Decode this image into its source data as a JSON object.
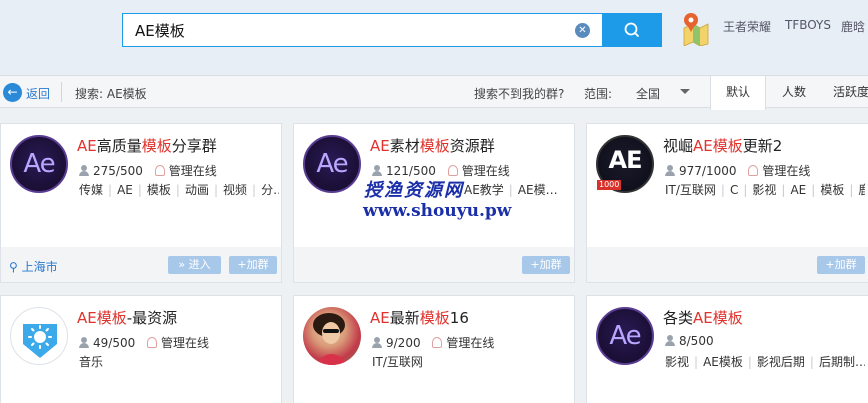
{
  "search": {
    "value": "AE模板",
    "clear_glyph": "✕"
  },
  "hot_tags": [
    "王者荣耀",
    "TFBOYS",
    "鹿晗"
  ],
  "filter_bar": {
    "back_label": "返回",
    "search_label": "搜索: AE模板",
    "not_found": "搜索不到我的群?",
    "range_label": "范围:",
    "range_value": "全国",
    "sort_tabs": [
      "默认",
      "人数",
      "活跃度"
    ]
  },
  "cards": [
    {
      "title_parts": [
        {
          "t": "AE",
          "hl": true
        },
        {
          "t": "高质量",
          "hl": false
        },
        {
          "t": "模板",
          "hl": true
        },
        {
          "t": "分享群",
          "hl": false
        }
      ],
      "members": "275/500",
      "admin": "管理在线",
      "tags": [
        "传媒",
        "AE",
        "模板",
        "动画",
        "视频",
        "分…"
      ],
      "location": "上海市",
      "enter_label": "» 进入",
      "join_label": "+加群"
    },
    {
      "title_parts": [
        {
          "t": "AE",
          "hl": true
        },
        {
          "t": "素材",
          "hl": false
        },
        {
          "t": "模板",
          "hl": true
        },
        {
          "t": "资源群",
          "hl": false
        }
      ],
      "members": "121/500",
      "admin": "管理在线",
      "tags": [
        "AE教学",
        "AE模…"
      ],
      "join_label": "+加群"
    },
    {
      "title_parts": [
        {
          "t": "视崛",
          "hl": false
        },
        {
          "t": "AE模板",
          "hl": true
        },
        {
          "t": "更新2",
          "hl": false
        }
      ],
      "members": "977/1000",
      "admin": "管理在线",
      "tags": [
        "IT/互联网",
        "C",
        "影视",
        "AE",
        "模板",
        "鹿晗"
      ],
      "badge": "1000",
      "join_label": "+加群"
    },
    {
      "title_parts": [
        {
          "t": "AE模板",
          "hl": true
        },
        {
          "t": "-最资源",
          "hl": false
        }
      ],
      "members": "49/500",
      "admin": "管理在线",
      "tags": [
        "音乐"
      ]
    },
    {
      "title_parts": [
        {
          "t": "AE",
          "hl": true
        },
        {
          "t": "最新",
          "hl": false
        },
        {
          "t": "模板",
          "hl": true
        },
        {
          "t": "16",
          "hl": false
        }
      ],
      "members": "9/200",
      "admin": "管理在线",
      "tags": [
        "IT/互联网"
      ]
    },
    {
      "title_parts": [
        {
          "t": "各类",
          "hl": false
        },
        {
          "t": "AE模板",
          "hl": true
        }
      ],
      "members": "8/500",
      "tags": [
        "影视",
        "AE模板",
        "影视后期",
        "后期制…"
      ]
    }
  ],
  "watermark": {
    "line1": "授渔资源网",
    "line2": "www.shouyu.pw"
  },
  "avatar_text": "Ae",
  "avatar_text_caps": "AE",
  "colors": {
    "accent": "#1e9be8",
    "highlight": "#e0332d",
    "link": "#2a7ad0"
  }
}
